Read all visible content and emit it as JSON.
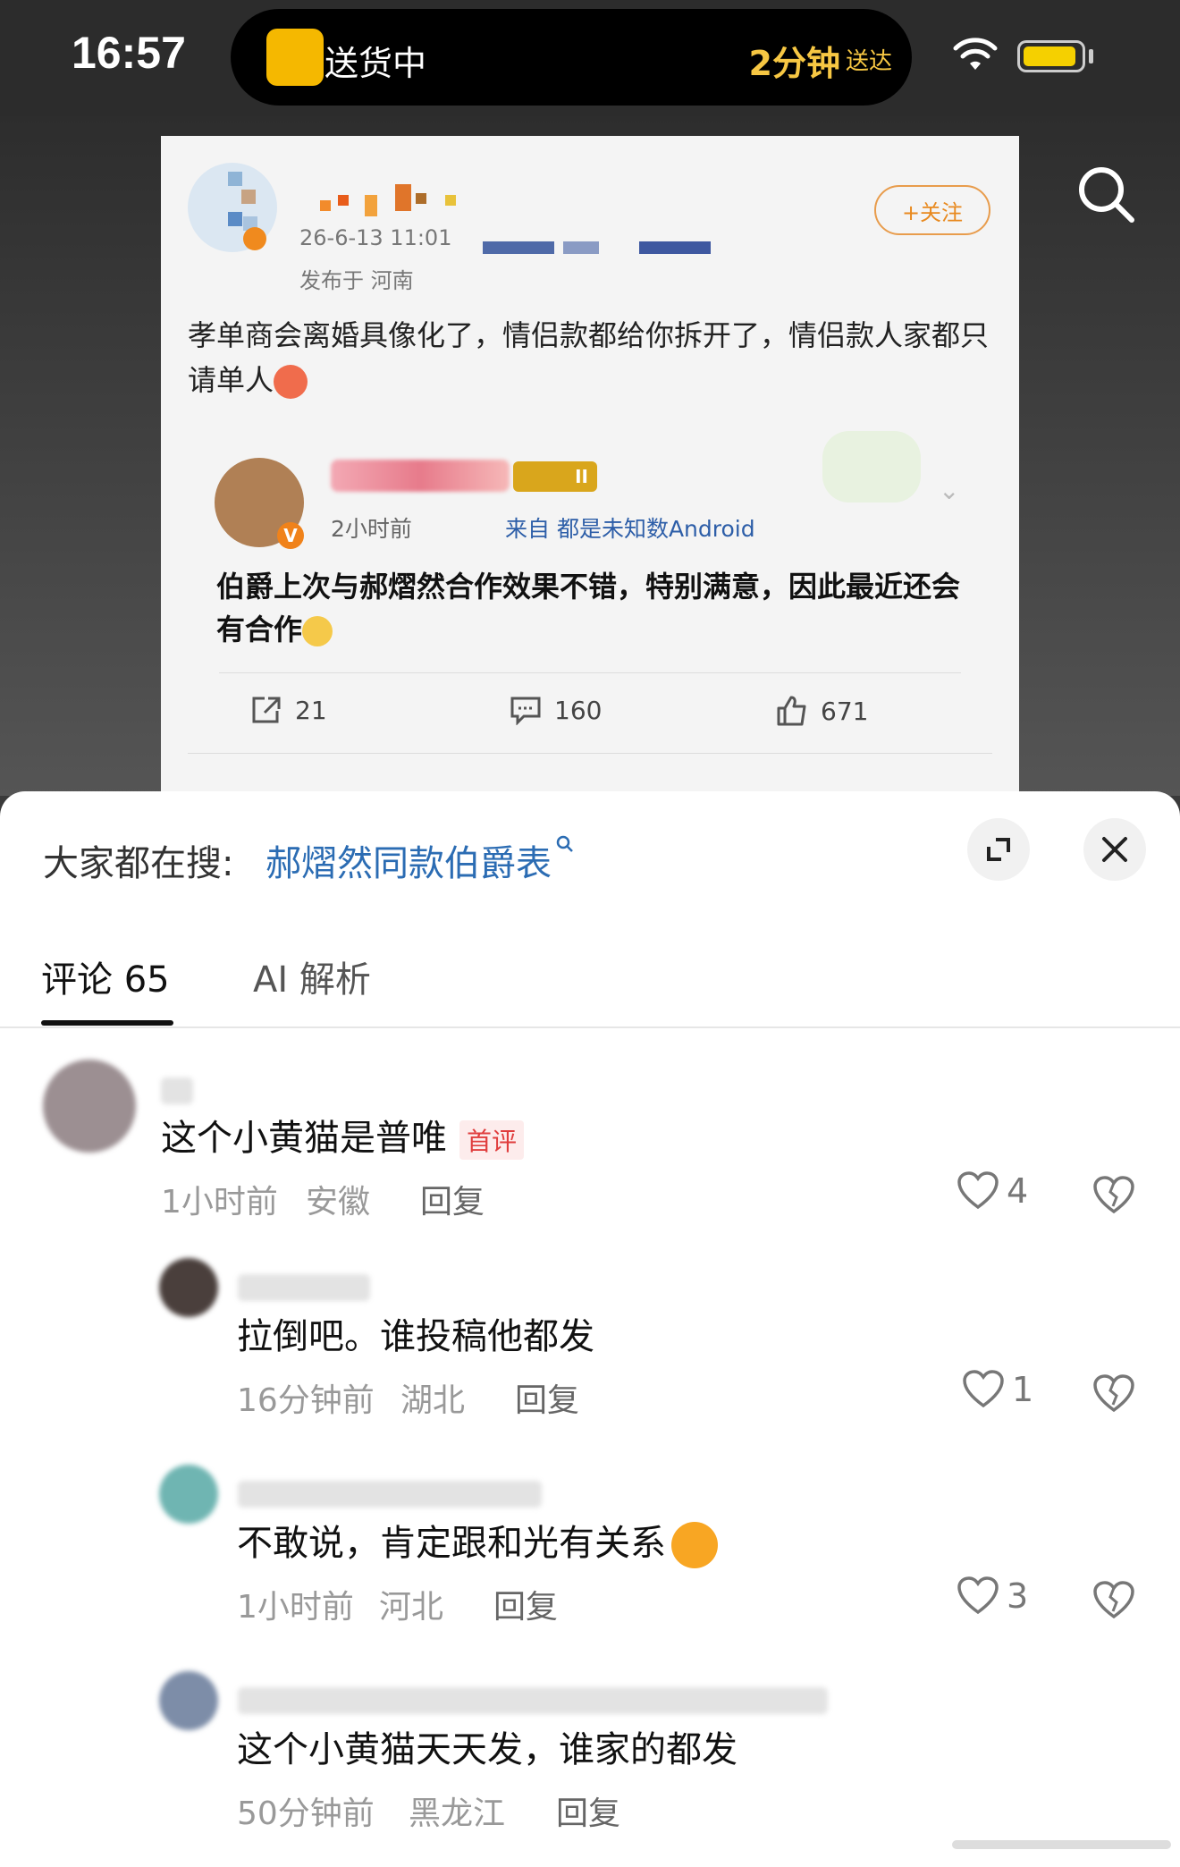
{
  "status_bar": {
    "time": "16:57",
    "island_label": "送货中",
    "island_eta": "2分钟",
    "island_eta_suffix": "送达",
    "colors": {
      "island_text": "#f7c743",
      "battery": "#f5d000"
    }
  },
  "post": {
    "date": "26-6-13 11:01",
    "location": "发布于 河南",
    "follow_label": "+关注",
    "text": "孝单商会离婚具像化了，情侣款都给你拆开了，情侣款人家都只请单人",
    "repost": {
      "time": "2小时前",
      "source": "来自 都是未知数Android",
      "badge_icon": "verified-v",
      "crown_label": "II",
      "text": "伯爵上次与郝熠然合作效果不错，特别满意，因此最近还会有合作"
    },
    "stats": {
      "reposts": "21",
      "comments": "160",
      "likes": "671"
    }
  },
  "sheet": {
    "search_prefix": "大家都在搜:",
    "search_term": "郝熠然同款伯爵表",
    "tabs": [
      {
        "label": "评论 65",
        "active": true
      },
      {
        "label": "AI 解析",
        "active": false
      }
    ]
  },
  "comments": [
    {
      "text": "这个小黄猫是普唯",
      "tag": "首评",
      "time": "1小时前",
      "region": "安徽",
      "reply": "回复",
      "likes": "4"
    },
    {
      "text": "拉倒吧。谁投稿他都发",
      "time": "16分钟前",
      "region": "湖北",
      "reply": "回复",
      "likes": "1"
    },
    {
      "text": "不敢说，肯定跟和光有关系",
      "time": "1小时前",
      "region": "河北",
      "reply": "回复",
      "likes": "3"
    },
    {
      "text": "这个小黄猫天天发，谁家的都发",
      "time": "50分钟前",
      "region": "黑龙江",
      "reply": "回复"
    }
  ]
}
